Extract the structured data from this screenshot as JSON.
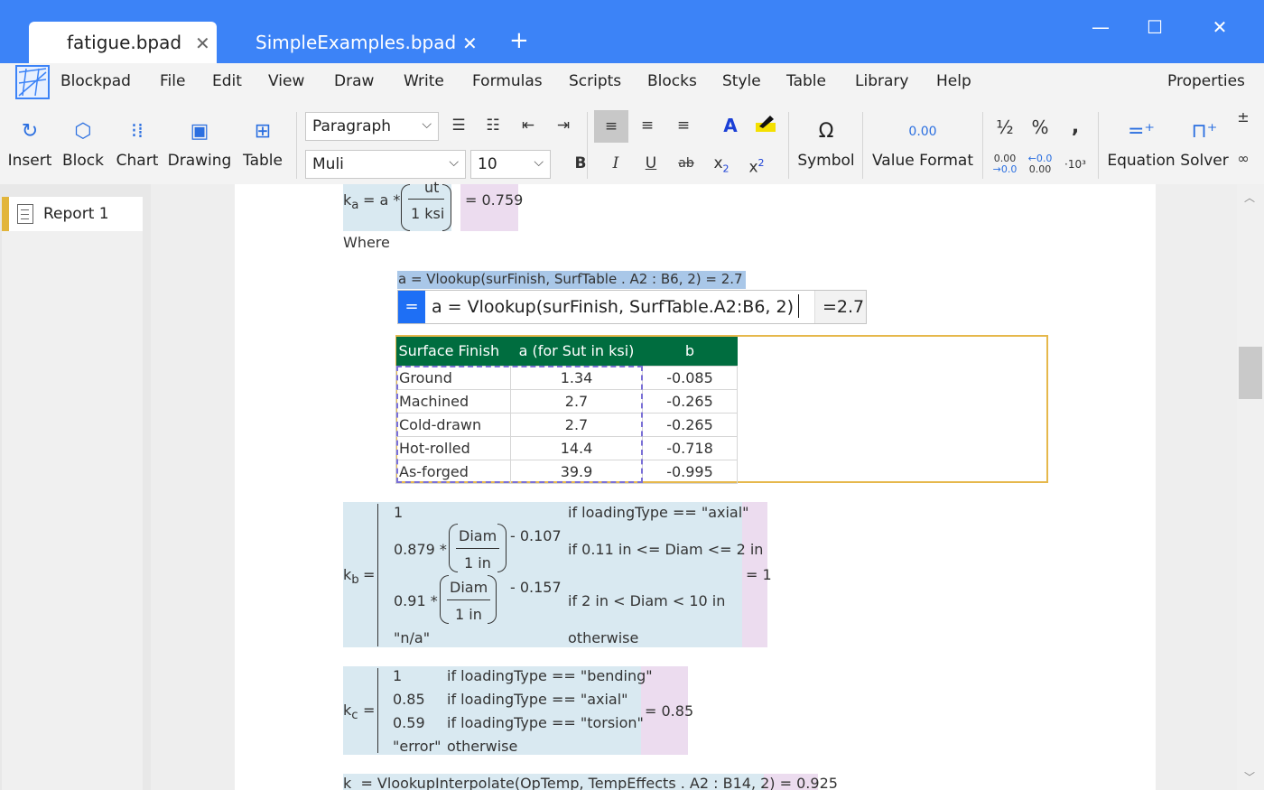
{
  "window": {
    "tabs": [
      {
        "label": "fatigue.bpad",
        "active": true
      },
      {
        "label": "SimpleExamples.bpad",
        "active": false
      }
    ],
    "new_tab_icon": "plus-icon",
    "controls": {
      "minimize": "—",
      "maximize": "☐",
      "close": "✕"
    },
    "accent_color": "#3c83f7"
  },
  "menubar": {
    "app_name": "Blockpad",
    "items": [
      "File",
      "Edit",
      "View",
      "Draw",
      "Write",
      "Formulas",
      "Scripts",
      "Blocks",
      "Style",
      "Table",
      "Library",
      "Help"
    ],
    "properties": "Properties"
  },
  "ribbon": {
    "insert_group": [
      "Insert",
      "Block",
      "Chart",
      "Drawing",
      "Table"
    ],
    "paragraph_style": "Paragraph",
    "font_family": "Muli",
    "font_size": "10",
    "format": {
      "bold": "B",
      "italic": "I",
      "underline": "U",
      "strike": "ab",
      "subscript": "x",
      "sub_char": "2",
      "superscript": "x",
      "sup_char": "2"
    },
    "symbol": {
      "glyph": "Ω",
      "label": "Symbol"
    },
    "value_format": {
      "glyph": "0.00",
      "label": "Value Format"
    },
    "number_format": {
      "fraction": "½",
      "percent": "%",
      "comma": ",",
      "inc_decimal_top": "0.00",
      "inc_decimal_bottom": "→0.0",
      "dec_decimal_top": "←0.0",
      "dec_decimal_bottom": "0.00",
      "sci": "·10³"
    },
    "equation": "Equation",
    "solver": "Solver"
  },
  "sidebar": {
    "pages": [
      {
        "label": "Report 1",
        "selected": true
      }
    ]
  },
  "doc": {
    "ka": {
      "lhs": "k",
      "sub": "a",
      "eq": "= a *",
      "num": "ut",
      "den": "1 ksi",
      "result": "= 0.759"
    },
    "where": "Where",
    "a_formula_selected": "a = Vlookup(surFinish, SurfTable . A2 : B6, 2) = 2.7",
    "a_edit": {
      "button": "=",
      "text": "a = Vlookup(surFinish, SurfTable.A2:B6, 2)",
      "result": "=2.7"
    },
    "surf_table": {
      "headers": [
        "Surface Finish",
        "a (for Sut in ksi)",
        "b"
      ],
      "rows": [
        [
          "Ground",
          "1.34",
          "-0.085"
        ],
        [
          "Machined",
          "2.7",
          "-0.265"
        ],
        [
          "Cold-drawn",
          "2.7",
          "-0.265"
        ],
        [
          "Hot-rolled",
          "14.4",
          "-0.718"
        ],
        [
          "As-forged",
          "39.9",
          "-0.995"
        ]
      ],
      "header_color": "#006d3f"
    },
    "kb": {
      "lhs": "k",
      "sub": "b",
      "eq": "=",
      "case1_val": "1",
      "case1_cond": "if loadingType == \"axial\"",
      "case2_coef": "0.879 *",
      "case2_num": "Diam",
      "case2_den": "1 in",
      "case2_exp": "- 0.107",
      "case2_cond": "if 0.11 in <= Diam <= 2 in",
      "case3_coef": "0.91 *",
      "case3_num": "Diam",
      "case3_den": "1 in",
      "case3_exp": "- 0.157",
      "case3_cond": "if 2 in < Diam < 10 in",
      "case4_val": "\"n/a\"",
      "case4_cond": "otherwise",
      "result": "= 1"
    },
    "kc": {
      "lhs": "k",
      "sub": "c",
      "eq": "=",
      "cases": [
        {
          "val": "1",
          "cond": "if loadingType == \"bending\""
        },
        {
          "val": "0.85",
          "cond": "if loadingType == \"axial\""
        },
        {
          "val": "0.59",
          "cond": "if loadingType == \"torsion\""
        },
        {
          "val": "\"error\"",
          "cond": "otherwise"
        }
      ],
      "result": "= 0.85"
    },
    "kd_partial": "k  = VlookupInterpolate(OpTemp, TempEffects . A2 : B14, 2) = 0.925"
  }
}
